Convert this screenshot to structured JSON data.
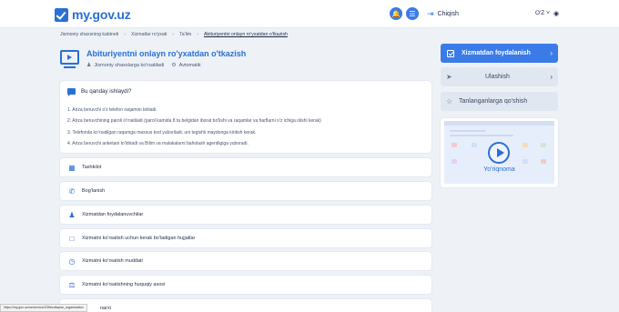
{
  "header": {
    "logo_text": "my.gov.uz",
    "logout_label": "Chiqish",
    "language": "O'Z",
    "bell_icon": "bell-icon",
    "menu_icon": "menu-icon",
    "eye_icon": "eye-icon"
  },
  "breadcrumb": [
    "Jismoniy shaxsning kabineti",
    "Xizmatlar ro'yxati",
    "Ta'lim",
    "Abituriyentni onlayn ro'yxatdan o'tkazish"
  ],
  "service": {
    "title": "Abituriyentni onlayn ro'yxatdan o'tkazish",
    "audience": "Jismoniy shaxslarga ko'rsatiladi",
    "mode": "Avtomatik"
  },
  "how_it_works": {
    "heading": "Bu qanday ishlaydi?",
    "steps": [
      "1. Ariza beruvchi o'z telefon raqamini kiritadi.",
      "2. Ariza beruvchining paroli o'rnatiladi (parol kamida 8 ta belgidan iborat bo'lishi va raqamlar va harflarni o'z ichiga olishi kerak)",
      "3. Telefonda ko'rsatilgan raqamga maxsus kod yuboriladi, uni tegishli maydonga kiritish kerak.",
      "4. Ariza beruvchi anketani to'ldiradi va Bilim va malakalarni baholash agentligiga yuboradi."
    ]
  },
  "sections": [
    {
      "label": "Tashkilot",
      "icon": "building-icon"
    },
    {
      "label": "Bog'lanish",
      "icon": "phone-icon"
    },
    {
      "label": "Xizmatdan foydalanuvchilar",
      "icon": "user-icon"
    },
    {
      "label": "Xizmatni ko'rsatish uchun kerak bo'ladigan hujjatlar",
      "icon": "document-icon"
    },
    {
      "label": "Xizmatni ko'rsatish muddati",
      "icon": "clock-icon"
    },
    {
      "label": "Xizmatni ko'rsatishning huquqiy asosi",
      "icon": "scales-icon"
    }
  ],
  "partial_row_label": "narxi",
  "sidebar": {
    "use_service": "Xizmatdan foydalanish",
    "share": "Ulashish",
    "favorite": "Tanlanganlarga qo'shish",
    "video_label": "Yo'riqnoma"
  },
  "status_bar_url": "https://my.gov.uz/oz/service/239#collapse_organisation",
  "colors": {
    "accent": "#3b7be8",
    "brand": "#2a6fd6",
    "background": "#eef2f7"
  }
}
